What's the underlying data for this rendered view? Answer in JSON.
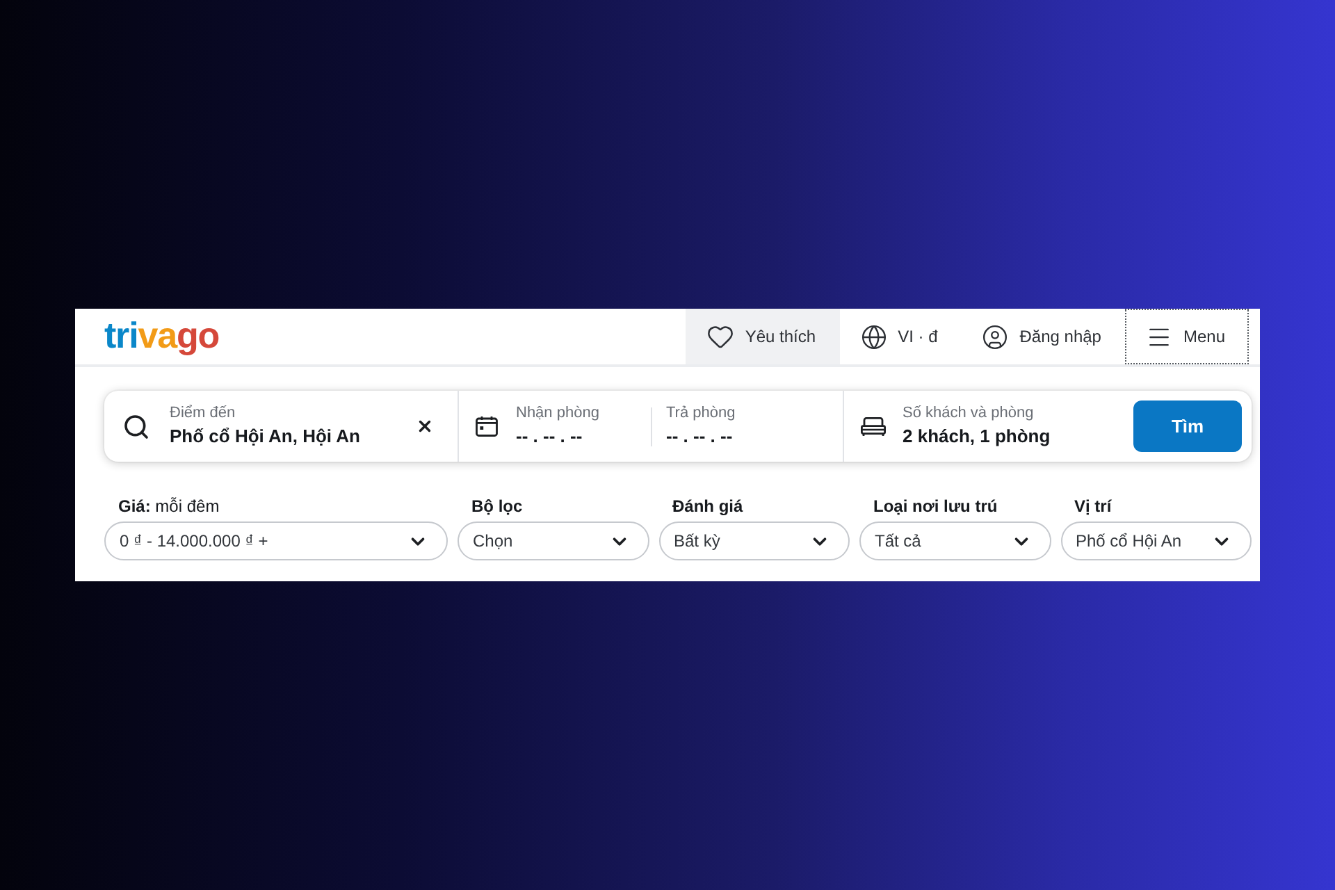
{
  "header": {
    "logo": [
      {
        "text": "tri",
        "color": "#0a87c9"
      },
      {
        "text": "va",
        "color": "#f29b17"
      },
      {
        "text": "go",
        "color": "#d5483a"
      }
    ],
    "nav": [
      {
        "kind": "heart",
        "label": "Yêu thích",
        "selected": true,
        "focused": false
      },
      {
        "kind": "globe",
        "label": "VI · đ",
        "selected": false,
        "focused": false
      },
      {
        "kind": "user",
        "label": "Đăng nhập",
        "selected": false,
        "focused": false
      },
      {
        "kind": "menu",
        "label": "Menu",
        "selected": false,
        "focused": true
      }
    ]
  },
  "search": {
    "destination": {
      "label": "Điểm đến",
      "value": "Phố cổ Hội An, Hội An"
    },
    "check_in": {
      "label": "Nhận phòng",
      "value": "-- . -- . --"
    },
    "check_out": {
      "label": "Trả phòng",
      "value": "-- . -- . --"
    },
    "guests": {
      "label": "Số khách và phòng",
      "value": "2 khách, 1 phòng"
    },
    "button": "Tìm"
  },
  "filters": [
    {
      "kind": "range",
      "label": "**Giá:** mỗi đêm",
      "value": "0 ₫ - 14.000.000 ₫ +"
    },
    {
      "kind": "select",
      "label": "Bộ lọc",
      "value": "Chọn"
    },
    {
      "kind": "select",
      "label": "Đánh giá",
      "value": "Bất kỳ"
    },
    {
      "kind": "select",
      "label": "Loại nơi lưu trú",
      "value": "Tất cả"
    },
    {
      "kind": "select",
      "label": "Vị trí",
      "value": "Phố cổ Hội An"
    }
  ]
}
